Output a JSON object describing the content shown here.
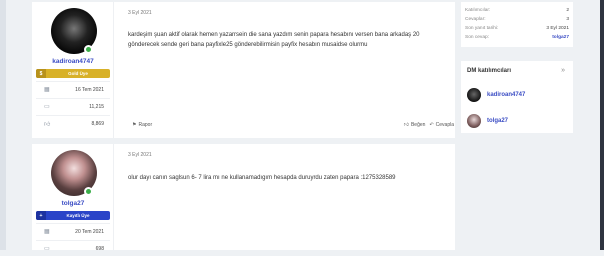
{
  "posts": [
    {
      "username": "kadiroan4747",
      "badge": "Gold Üye",
      "stats": [
        {
          "icon": "calendar-icon",
          "value": "16 Tem 2021"
        },
        {
          "icon": "messages-icon",
          "value": "11,215"
        },
        {
          "icon": "thumbs-up-icon",
          "value": "8,869"
        }
      ],
      "date": "3 Eyl 2021",
      "message": "kardeşim şuan aktif olarak hemen yazarrsein die sana yazdım senin papara hesabını versen bana arkadaş 20 gönderecek sende geri bana payfixle25 gönderebilirmisin payfix hesabın musaidse olurmu",
      "report_label": "Rapor",
      "like_label": "Beğen",
      "reply_label": "Cevapla"
    },
    {
      "username": "tolga27",
      "badge": "Kayıtlı Üye",
      "stats": [
        {
          "icon": "calendar-icon",
          "value": "20 Tem 2021"
        },
        {
          "icon": "messages-icon",
          "value": "698"
        }
      ],
      "date": "3 Eyl 2021",
      "message": "olur dayı canın saglsun 6- 7 lira mı ne kullanamadıgım hesapda duruyrdu zaten papara :1275328589"
    }
  ],
  "info": {
    "rows": [
      {
        "label": "Katılımcılar:",
        "value": "2"
      },
      {
        "label": "Cevaplar:",
        "value": "3"
      },
      {
        "label": "Son yanıt tarihi:",
        "value": "3 Eyl 2021"
      },
      {
        "label": "Son cevap:",
        "value": "tolga27"
      }
    ]
  },
  "dm": {
    "title": "DM katılımcıları",
    "toggle": "»",
    "participants": [
      {
        "name": "kadiroan4747"
      },
      {
        "name": "tolga27"
      }
    ]
  },
  "colors": {
    "link": "#3a4cc4",
    "gold_badge": "#d8b128",
    "registered_badge": "#2a44c8",
    "online": "#3cae4a",
    "background": "#eef1f4"
  }
}
